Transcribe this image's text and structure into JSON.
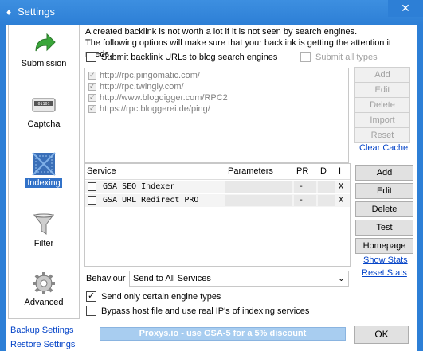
{
  "window": {
    "title": "Settings",
    "close_glyph": "✕"
  },
  "nav": {
    "items": [
      {
        "label": "Submission",
        "icon": "green-arrow-icon"
      },
      {
        "label": "Captcha",
        "icon": "captcha-icon"
      },
      {
        "label": "Indexing",
        "icon": "indexing-icon"
      },
      {
        "label": "Filter",
        "icon": "funnel-icon"
      },
      {
        "label": "Advanced",
        "icon": "gear-icon"
      }
    ],
    "active_index": 2,
    "links": {
      "backup": "Backup Settings",
      "restore": "Restore Settings"
    }
  },
  "intro": {
    "line1": "A created backlink is not worth a lot if it is not seen by search engines.",
    "line2": "The following options will make sure that your backlink is getting the attention it needs."
  },
  "blog_search": {
    "label": "Submit backlink URLs to blog search engines",
    "checked": false,
    "submit_all_label": "Submit all types",
    "urls": [
      "http://rpc.pingomatic.com/",
      "http://rpc.twingly.com/",
      "http://www.blogdigger.com/RPC2",
      "https://rpc.bloggerei.de/ping/"
    ],
    "buttons": {
      "add": "Add",
      "edit": "Edit",
      "delete": "Delete",
      "import": "Import",
      "reset": "Reset"
    },
    "clear_cache": "Clear Cache"
  },
  "services": {
    "headers": {
      "service": "Service",
      "parameters": "Parameters",
      "pr": "PR",
      "d": "D",
      "i": "I"
    },
    "rows": [
      {
        "name": "GSA SEO Indexer",
        "parameters": "",
        "pr": "-",
        "d": "",
        "i": "X"
      },
      {
        "name": "GSA URL Redirect PRO",
        "parameters": "",
        "pr": "-",
        "d": "",
        "i": "X"
      }
    ],
    "buttons": {
      "add": "Add",
      "edit": "Edit",
      "delete": "Delete",
      "test": "Test",
      "homepage": "Homepage"
    },
    "show_stats": "Show Stats",
    "reset_stats": "Reset Stats"
  },
  "behaviour": {
    "label": "Behaviour",
    "value": "Send to All Services",
    "chevron": "⌄"
  },
  "options": {
    "only_certain": {
      "label": "Send only certain engine types",
      "checked": true
    },
    "bypass_host": {
      "label": "Bypass host file and use real IP's of indexing services",
      "checked": false
    }
  },
  "footer": {
    "banner": "Proxys.io - use GSA-5 for a 5% discount",
    "ok": "OK"
  },
  "colors": {
    "titlebar": "#2d7fd6",
    "link": "#0645c8",
    "banner": "#a8cdf0"
  }
}
